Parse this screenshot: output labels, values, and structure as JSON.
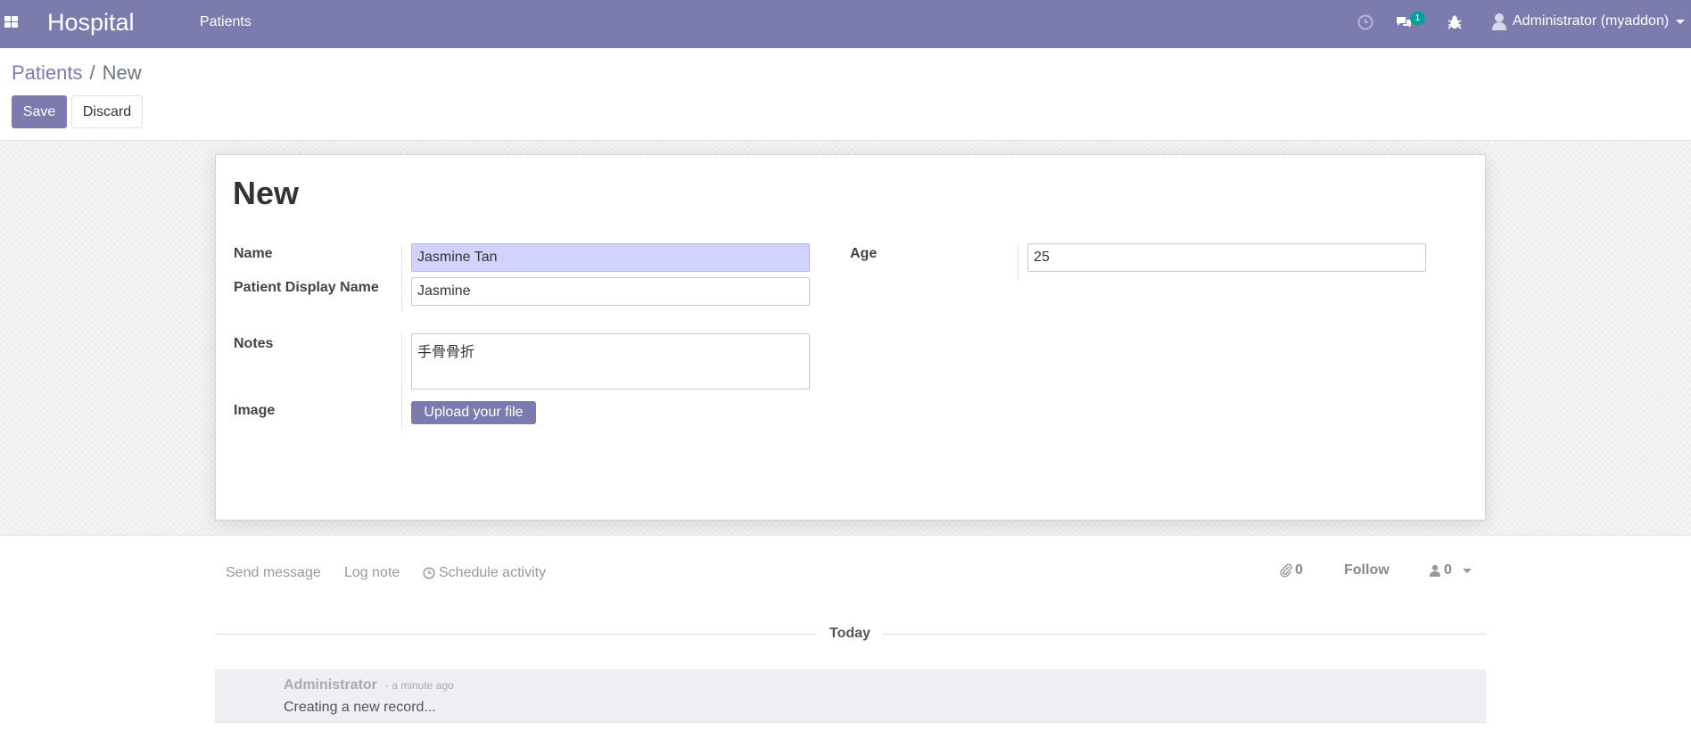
{
  "navbar": {
    "brand": "Hospital",
    "menu_patients": "Patients",
    "chat_badge": "1",
    "user": "Administrator (myaddon)",
    "icons": [
      "apps-icon",
      "clock-icon",
      "chat-icon",
      "bug-icon",
      "user-avatar-icon"
    ]
  },
  "breadcrumb": {
    "parent": "Patients",
    "separator": "/",
    "current": "New"
  },
  "buttons": {
    "save": "Save",
    "discard": "Discard"
  },
  "form": {
    "title": "New",
    "name_label": "Name",
    "name_value": "Jasmine Tan",
    "display_name_label": "Patient Display Name",
    "display_name_value": "Jasmine",
    "notes_label": "Notes",
    "notes_value": "手骨骨折",
    "image_label": "Image",
    "upload_label": "Upload your file",
    "age_label": "Age",
    "age_value": "25"
  },
  "chatter": {
    "send_message": "Send message",
    "log_note": "Log note",
    "schedule_activity": "Schedule activity",
    "attachments_count": "0",
    "follow": "Follow",
    "followers_count": "0",
    "today": "Today",
    "message": {
      "author": "Administrator",
      "date": "- a minute ago",
      "body": "Creating a new record..."
    }
  },
  "colors": {
    "brand": "#7c7bad",
    "required_field": "#d2d2ff",
    "badge": "#00a09d"
  }
}
